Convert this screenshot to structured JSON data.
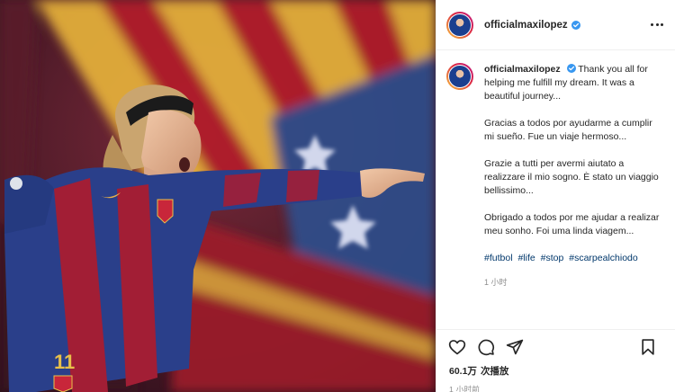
{
  "account": {
    "username": "officialmaxilopez",
    "verified": true
  },
  "header": {
    "more_icon": "more-horizontal-icon"
  },
  "caption": {
    "username": "officialmaxilopez",
    "paragraphs": [
      "Thank you all for helping me fulfill my dream. It was a beautiful journey...",
      "Gracias a todos por ayudarme a cumplir mi sueño. Fue un viaje hermoso...",
      "Grazie a tutti per avermi aiutato a realizzare il mio sogno. È stato un viaggio bellissimo...",
      "Obrigado a todos por me ajudar a realizar meu sonho. Foi uma linda viagem..."
    ],
    "hashtags": [
      "#futbol",
      "#life",
      "#stop",
      "#scarpealchiodo"
    ],
    "time": "1 小时"
  },
  "actions": {
    "like_icon": "heart-icon",
    "comment_icon": "comment-icon",
    "share_icon": "send-icon",
    "save_icon": "bookmark-icon"
  },
  "stats": {
    "views": "60.1万",
    "views_label": "次播放",
    "posted": "1 小时前"
  },
  "colors": {
    "verified": "#3897f0",
    "hashtag": "#00376b",
    "muted": "#8e8e8e"
  }
}
